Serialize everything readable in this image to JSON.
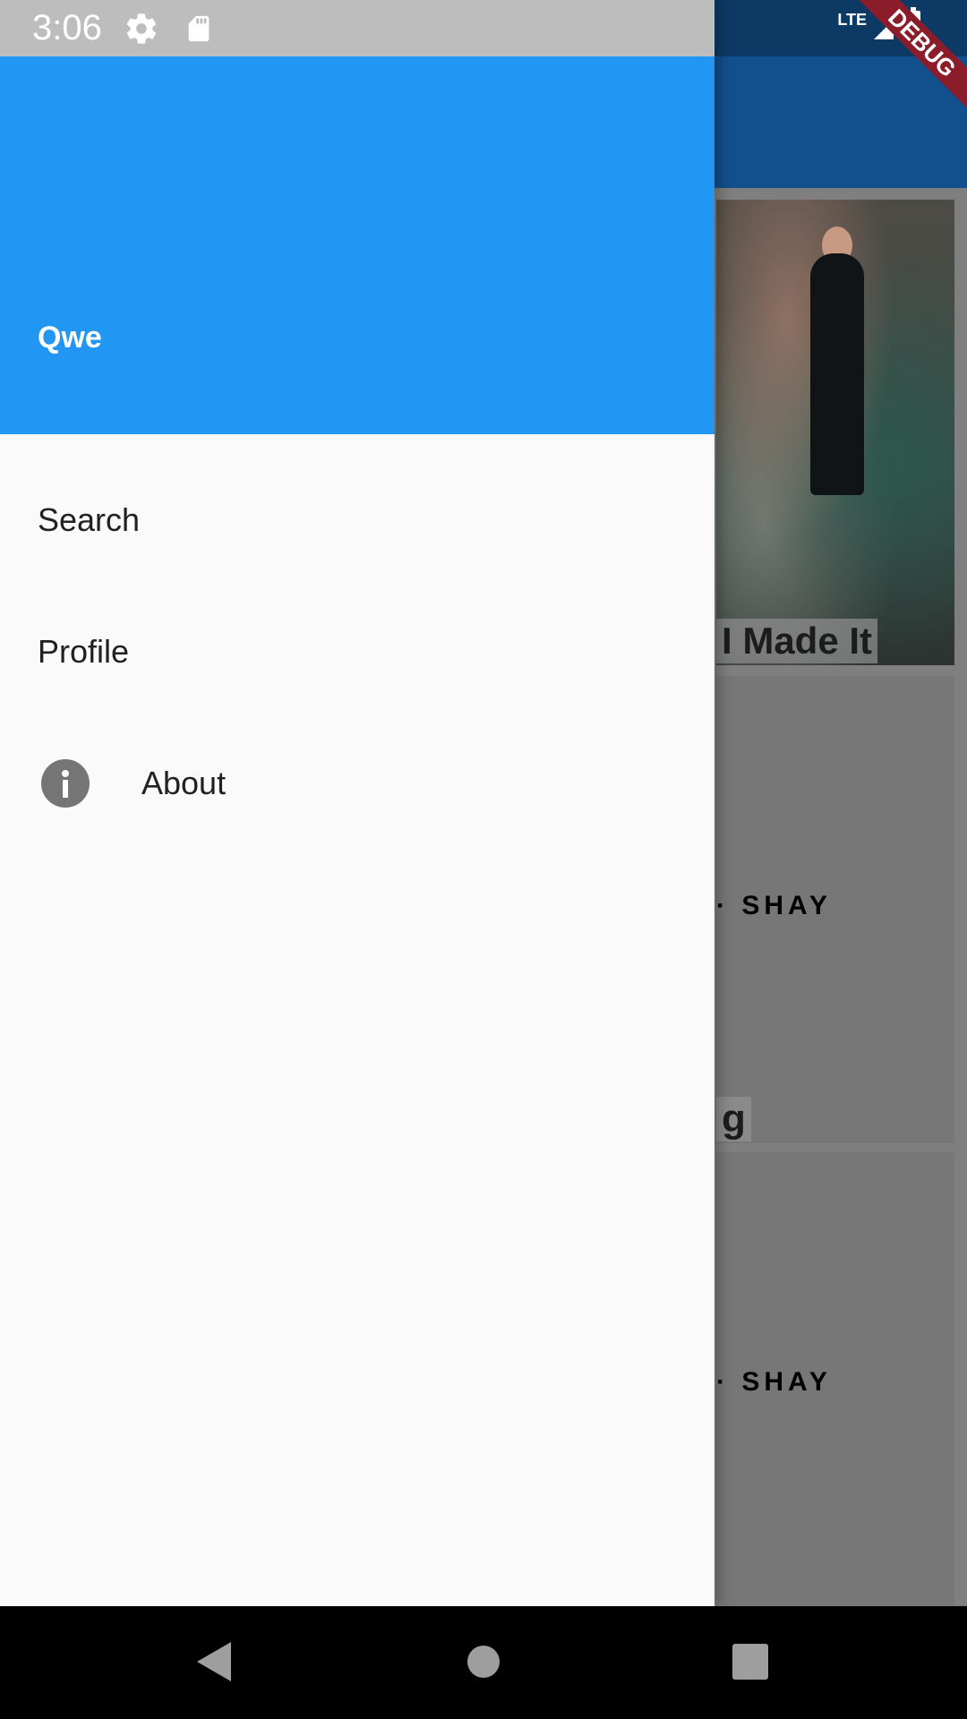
{
  "status_bar": {
    "time": "3:06",
    "network": "LTE"
  },
  "debug_banner": "DEBUG",
  "drawer": {
    "header": {
      "name": "Qwe",
      "color": "#2196f3"
    },
    "items": [
      {
        "label": "Search"
      },
      {
        "label": "Profile"
      },
      {
        "label": "About",
        "icon": "info-icon"
      }
    ]
  },
  "background": {
    "cards": [
      {
        "title": "I Made It"
      },
      {
        "text": "SHAY",
        "title": "g"
      },
      {
        "text": "SHAY"
      }
    ]
  },
  "navbar": {
    "icons": [
      "back-icon",
      "home-icon",
      "recents-icon"
    ]
  }
}
